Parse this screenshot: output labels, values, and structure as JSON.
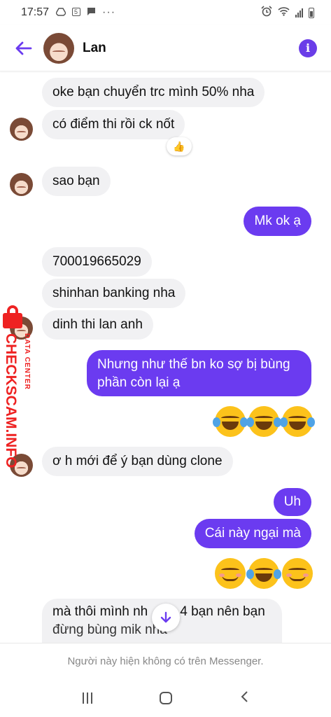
{
  "status_bar": {
    "time": "17:57",
    "notification_icons": [
      "drive-icon",
      "calendar-icon",
      "chat-icon",
      "more-dots-icon"
    ],
    "calendar_day": "5",
    "system_icons": [
      "alarm-icon",
      "wifi-icon",
      "signal-icon",
      "battery-icon"
    ]
  },
  "header": {
    "contact_name": "Lan",
    "info_glyph": "i"
  },
  "colors": {
    "accent": "#6b3bf0",
    "incoming_bubble": "#f1f1f3",
    "watermark": "#e22222"
  },
  "messages": [
    {
      "direction": "in",
      "text": "oke bạn chuyển trc mình 50% nha"
    },
    {
      "direction": "in",
      "text": "có điểm thi rồi ck nốt",
      "reaction": "👍"
    },
    {
      "direction": "in",
      "text": "sao bạn"
    },
    {
      "direction": "out",
      "text": "Mk ok ạ"
    },
    {
      "direction": "in",
      "text": "700019665029"
    },
    {
      "direction": "in",
      "text": "shinhan banking nha"
    },
    {
      "direction": "in",
      "text": "dinh thi lan anh"
    },
    {
      "direction": "out",
      "text_line1": "Nhưng như thế bn ko sợ bị bùng",
      "text_line2": "phần còn lại ạ"
    },
    {
      "direction": "out",
      "emojis": [
        "laughing-tears-emoji",
        "laughing-tears-emoji",
        "laughing-tears-emoji"
      ]
    },
    {
      "direction": "in",
      "text": "ơ h mới để ý bạn dùng clone"
    },
    {
      "direction": "out",
      "text": "Uh"
    },
    {
      "direction": "out",
      "text": "Cái này ngại mà"
    },
    {
      "direction": "out",
      "emojis": [
        "blushing-smile-emoji",
        "laughing-tears-emoji",
        "blushing-smile-emoji"
      ]
    },
    {
      "direction": "in",
      "text_line1": "mà thôi mình nh",
      "text_line1_tail": "4 bạn nên bạn",
      "text_line2": "đừng bùng mik nha"
    }
  ],
  "watermark": {
    "brand": "CHECKSCAM.INFO",
    "tagline": "DATA CENTER"
  },
  "footer": {
    "notice": "Người này hiện không có trên Messenger."
  },
  "nav_bar": {
    "buttons": [
      "recents-button",
      "home-button",
      "back-button"
    ]
  }
}
